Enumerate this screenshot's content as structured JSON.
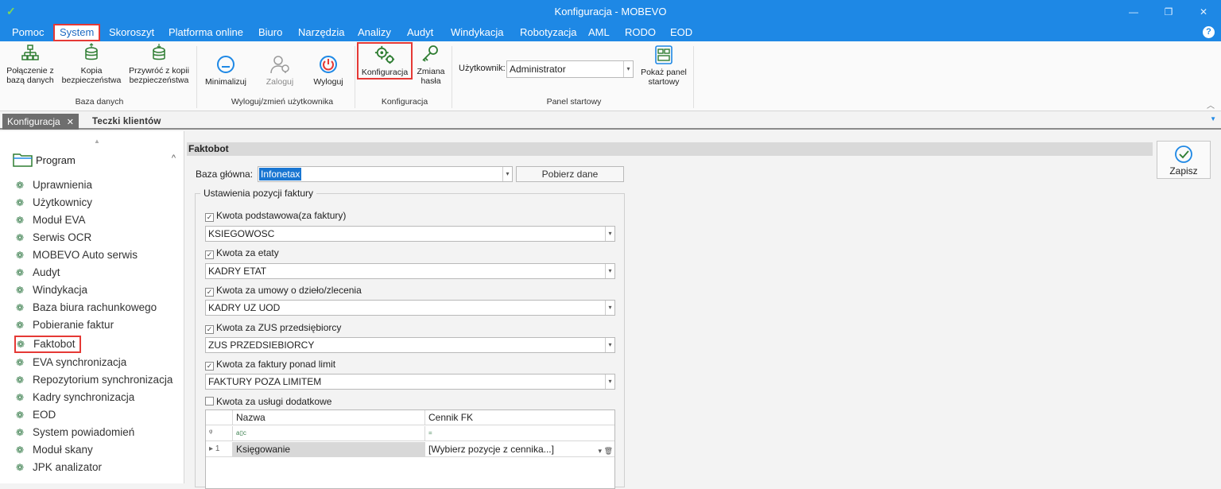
{
  "window": {
    "title": "Konfiguracja - MOBEVO"
  },
  "menu": [
    "Pomoc",
    "System",
    "Skoroszyt",
    "Platforma online",
    "Biuro",
    "Narzędzia",
    "Analizy",
    "Audyt",
    "Windykacja",
    "Robotyzacja",
    "AML",
    "RODO",
    "EOD"
  ],
  "menu_active": "System",
  "ribbon": {
    "db_connect": "Połączenie z bazą danych",
    "backup": "Kopia bezpieczeństwa",
    "restore": "Przywróć z kopii bezpieczeństwa",
    "group_db": "Baza danych",
    "minimize": "Minimalizuj",
    "login": "Zaloguj",
    "logout": "Wyloguj",
    "group_user": "Wyloguj/zmień użytkownika",
    "config": "Konfiguracja",
    "change_pass": "Zmiana hasła",
    "group_config": "Konfiguracja",
    "user_label": "Użytkownik:",
    "user_value": "Administrator",
    "show_panel": "Pokaż panel startowy",
    "group_start": "Panel startowy"
  },
  "tabs": {
    "active": "Konfiguracja",
    "other": "Teczki klientów"
  },
  "sidebar": {
    "group": "Program",
    "items": [
      "Uprawnienia",
      "Użytkownicy",
      "Moduł EVA",
      "Serwis OCR",
      "MOBEVO Auto serwis",
      "Audyt",
      "Windykacja",
      "Baza biura rachunkowego",
      "Pobieranie faktur",
      "Faktobot",
      "EVA synchronizacja",
      "Repozytorium synchronizacja",
      "Kadry synchronizacja",
      "EOD",
      "System powiadomień",
      "Moduł skany",
      "JPK analizator"
    ],
    "selected": "Faktobot"
  },
  "main": {
    "section": "Faktobot",
    "save": "Zapisz",
    "base_label": "Baza główna:",
    "base_value": "Infonetax",
    "fetch": "Pobierz dane",
    "legend": "Ustawienia pozycji faktury",
    "rows": [
      {
        "label": "Kwota podstawowa(za faktury)",
        "checked": true,
        "value": "KSIEGOWOSC"
      },
      {
        "label": "Kwota za etaty",
        "checked": true,
        "value": "KADRY ETAT"
      },
      {
        "label": "Kwota za umowy o dzieło/zlecenia",
        "checked": true,
        "value": "KADRY UZ UOD"
      },
      {
        "label": "Kwota za ZUS przedsiębiorcy",
        "checked": true,
        "value": "ZUS PRZEDSIEBIORCY"
      },
      {
        "label": "Kwota za faktury ponad limit",
        "checked": true,
        "value": "FAKTURY POZA LIMITEM"
      }
    ],
    "extra_label": "Kwota za usługi dodatkowe",
    "grid": {
      "col_name": "Nazwa",
      "col_price": "Cennik FK",
      "filter_row_name": "a▯c",
      "filter_row_price": "=",
      "row_index": "1",
      "row_name": "Księgowanie",
      "row_price": "[Wybierz pozycje z cennika...]"
    }
  }
}
